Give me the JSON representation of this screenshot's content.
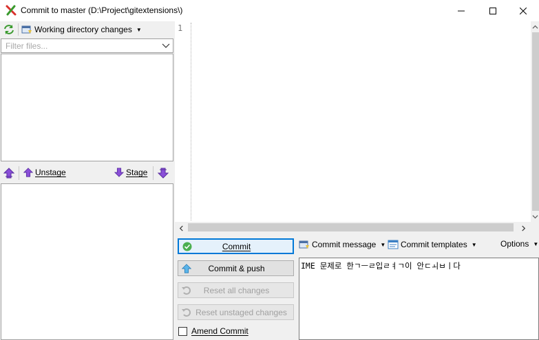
{
  "window": {
    "title": "Commit to master (D:\\Project\\gitextensions\\)",
    "controls": {
      "minimize": "—",
      "maximize": "☐",
      "close": "✕"
    }
  },
  "left": {
    "working_dir_label": "Working directory changes",
    "filter_placeholder": "Filter files...",
    "unstage_label": "Unstage",
    "stage_label": "Stage"
  },
  "diff": {
    "line_number": "1"
  },
  "buttons": {
    "commit": "Commit",
    "commit_push": "Commit & push",
    "reset_all": "Reset all changes",
    "reset_unstaged": "Reset unstaged changes"
  },
  "message_toolbar": {
    "commit_message": "Commit message",
    "commit_templates": "Commit templates",
    "options": "Options"
  },
  "commit_message_text": "IME 문제로 한ㄱㅡㄹ입ㄹㅕㄱ이 안ㄷㅚㅂㅣ다",
  "amend": {
    "label": "Amend Commit",
    "checked": false
  },
  "colors": {
    "accent": "#0078d7",
    "panel_bg": "#f0f0f0",
    "stage_arrow": "#8a4fd8"
  }
}
